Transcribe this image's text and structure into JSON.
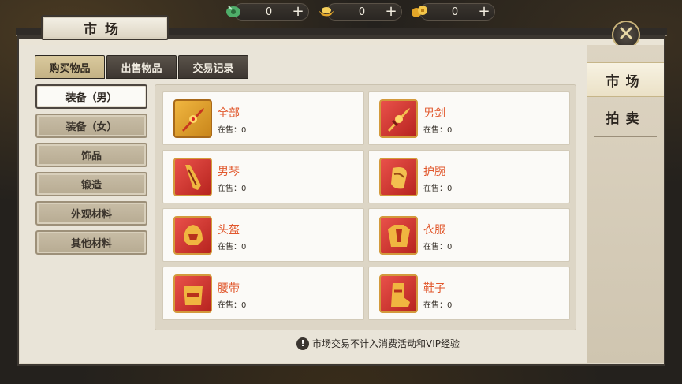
{
  "currencies": [
    {
      "icon": "jade-icon",
      "value": "0",
      "add": "+"
    },
    {
      "icon": "gold-ingot-icon",
      "value": "0",
      "add": "+"
    },
    {
      "icon": "coins-icon",
      "value": "0",
      "add": "+"
    }
  ],
  "title": "市场",
  "tabs": [
    "购买物品",
    "出售物品",
    "交易记录"
  ],
  "categories": [
    "装备（男）",
    "装备（女）",
    "饰品",
    "锻造",
    "外观材料",
    "其他材料"
  ],
  "items": [
    {
      "name": "全部",
      "stock": "在售：0",
      "icon": "weapon-icon"
    },
    {
      "name": "男剑",
      "stock": "在售：0",
      "icon": "sword-icon"
    },
    {
      "name": "男琴",
      "stock": "在售：0",
      "icon": "qin-icon"
    },
    {
      "name": "护腕",
      "stock": "在售：0",
      "icon": "bracer-icon"
    },
    {
      "name": "头盔",
      "stock": "在售：0",
      "icon": "helmet-icon"
    },
    {
      "name": "衣服",
      "stock": "在售：0",
      "icon": "armor-icon"
    },
    {
      "name": "腰带",
      "stock": "在售：0",
      "icon": "belt-icon"
    },
    {
      "name": "鞋子",
      "stock": "在售：0",
      "icon": "boots-icon"
    }
  ],
  "notice": "市场交易不计入消费活动和VIP经验",
  "side_tabs": [
    "市场",
    "拍卖"
  ],
  "colors": {
    "item_name": "#e1572c",
    "accent_gold": "#c9b37a"
  }
}
